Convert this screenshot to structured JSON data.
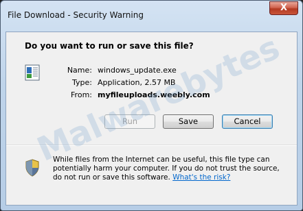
{
  "window": {
    "title": "File Download - Security Warning",
    "close_glyph": "X"
  },
  "dialog": {
    "question": "Do you want to run or save this file?",
    "fields": [
      {
        "label": "Name:",
        "value": "windows_update.exe"
      },
      {
        "label": "Type:",
        "value": "Application, 2.57 MB"
      },
      {
        "label": "From:",
        "value": "myfileuploads.weebly.com"
      }
    ],
    "buttons": {
      "run": "Run",
      "save": "Save",
      "cancel": "Cancel"
    },
    "warning": {
      "text": "While files from the Internet can be useful, this file type can potentially harm your computer. If you do not trust the source, do not run or save this software.",
      "link": "What's the risk?"
    }
  },
  "watermark": "Malwarebytes",
  "icons": {
    "file": "application-file-icon",
    "warning": "security-shield-icon"
  }
}
